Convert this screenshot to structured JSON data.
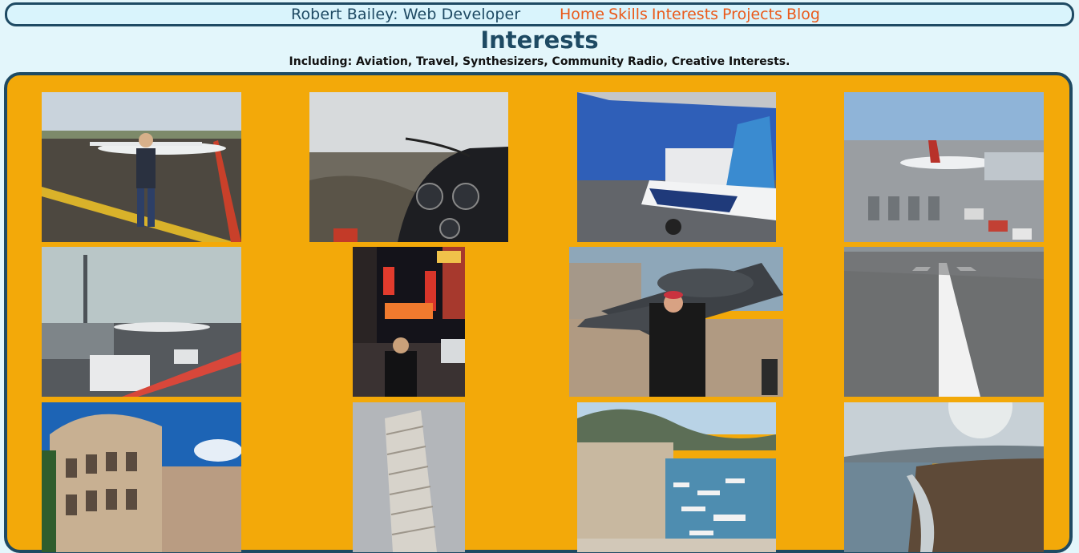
{
  "header": {
    "brand": "Robert Bailey: Web Developer",
    "nav": [
      "Home",
      "Skills",
      "Interests",
      "Projects",
      "Blog"
    ]
  },
  "page": {
    "title": "Interests",
    "subtitle": "Including: Aviation, Travel, Synthesizers, Community Radio, Creative Interests."
  },
  "colors": {
    "accent": "#ea5a1b",
    "brand": "#1e4a63",
    "gallery_bg": "#f3a909",
    "page_bg": "#e3f6fb"
  },
  "gallery": {
    "photos": [
      "photo-person-with-aircraft",
      "photo-cockpit-view",
      "photo-aircraft-tail",
      "photo-airport-apron",
      "photo-airport-terminal",
      "photo-city-night-street",
      "photo-jet-display",
      "photo-runway",
      "photo-colosseum",
      "photo-leaning-tower",
      "photo-harbour",
      "photo-coastline"
    ]
  }
}
